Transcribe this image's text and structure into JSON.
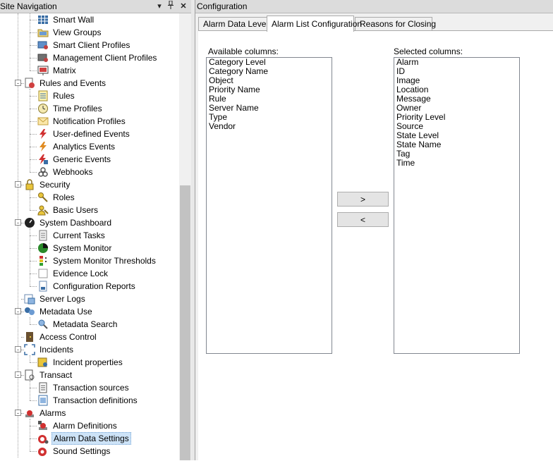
{
  "left_panel": {
    "title": "Site Navigation",
    "pin_glyph": "↓",
    "dock_glyph": "И",
    "close_glyph": "✕",
    "items": [
      {
        "label": "Smart Wall",
        "icon": "smart-wall-icon",
        "level": 2,
        "top": 0
      },
      {
        "label": "View Groups",
        "icon": "folder-icon",
        "level": 2
      },
      {
        "label": "Smart Client Profiles",
        "icon": "client-profile-icon",
        "level": 2
      },
      {
        "label": "Management Client Profiles",
        "icon": "management-profile-icon",
        "level": 2
      },
      {
        "label": "Matrix",
        "icon": "matrix-icon",
        "level": 2
      },
      {
        "label": "Rules and Events",
        "icon": "rules-events-icon",
        "level": 1,
        "expander": "-"
      },
      {
        "label": "Rules",
        "icon": "rules-icon",
        "level": 2
      },
      {
        "label": "Time Profiles",
        "icon": "clock-icon",
        "level": 2
      },
      {
        "label": "Notification Profiles",
        "icon": "envelope-icon",
        "level": 2
      },
      {
        "label": "User-defined Events",
        "icon": "lightning-icon",
        "level": 2
      },
      {
        "label": "Analytics Events",
        "icon": "analytics-event-icon",
        "level": 2
      },
      {
        "label": "Generic Events",
        "icon": "generic-event-icon",
        "level": 2
      },
      {
        "label": "Webhooks",
        "icon": "webhook-icon",
        "level": 2
      },
      {
        "label": "Security",
        "icon": "lock-icon",
        "level": 1,
        "expander": "-"
      },
      {
        "label": "Roles",
        "icon": "key-icon",
        "level": 2
      },
      {
        "label": "Basic Users",
        "icon": "user-icon",
        "level": 2
      },
      {
        "label": "System Dashboard",
        "icon": "dashboard-icon",
        "level": 1,
        "expander": "-"
      },
      {
        "label": "Current Tasks",
        "icon": "tasks-icon",
        "level": 2
      },
      {
        "label": "System Monitor",
        "icon": "monitor-icon",
        "level": 2
      },
      {
        "label": "System Monitor Thresholds",
        "icon": "threshold-icon",
        "level": 2
      },
      {
        "label": "Evidence Lock",
        "icon": "evidence-lock-icon",
        "level": 2
      },
      {
        "label": "Configuration Reports",
        "icon": "report-icon",
        "level": 2
      },
      {
        "label": "Server Logs",
        "icon": "server-log-icon",
        "level": 1
      },
      {
        "label": "Metadata Use",
        "icon": "metadata-icon",
        "level": 1,
        "expander": "-"
      },
      {
        "label": "Metadata Search",
        "icon": "metadata-search-icon",
        "level": 2
      },
      {
        "label": "Access Control",
        "icon": "access-control-icon",
        "level": 1
      },
      {
        "label": "Incidents",
        "icon": "incidents-icon",
        "level": 1,
        "expander": "-"
      },
      {
        "label": "Incident properties",
        "icon": "incident-properties-icon",
        "level": 2
      },
      {
        "label": "Transact",
        "icon": "transact-icon",
        "level": 1,
        "expander": "-"
      },
      {
        "label": "Transaction sources",
        "icon": "transaction-source-icon",
        "level": 2
      },
      {
        "label": "Transaction definitions",
        "icon": "transaction-definition-icon",
        "level": 2
      },
      {
        "label": "Alarms",
        "icon": "alarm-icon",
        "level": 1,
        "expander": "-"
      },
      {
        "label": "Alarm Definitions",
        "icon": "alarm-definition-icon",
        "level": 2
      },
      {
        "label": "Alarm Data Settings",
        "icon": "alarm-data-icon",
        "level": 2,
        "selected": true
      },
      {
        "label": "Sound Settings",
        "icon": "sound-icon",
        "level": 2
      }
    ]
  },
  "right_panel": {
    "title": "Configuration",
    "tabs": [
      {
        "label": "Alarm Data Levels",
        "active": false
      },
      {
        "label": "Alarm List Configuration",
        "active": true
      },
      {
        "label": "Reasons for Closing",
        "active": false
      }
    ],
    "available_label": "Available columns:",
    "selected_label": "Selected columns:",
    "available_columns": [
      "Category Level",
      "Category Name",
      "Object",
      "Priority Name",
      "Rule",
      "Server Name",
      "Type",
      "Vendor"
    ],
    "selected_columns": [
      "Alarm",
      "ID",
      "Image",
      "Location",
      "Message",
      "Owner",
      "Priority Level",
      "Source",
      "State Level",
      "State Name",
      "Tag",
      "Time"
    ],
    "add_button": ">",
    "remove_button": "<"
  },
  "colors": {
    "selection": "#cde3f7",
    "header": "#dcdcdc",
    "panel": "#f0f0f0"
  }
}
